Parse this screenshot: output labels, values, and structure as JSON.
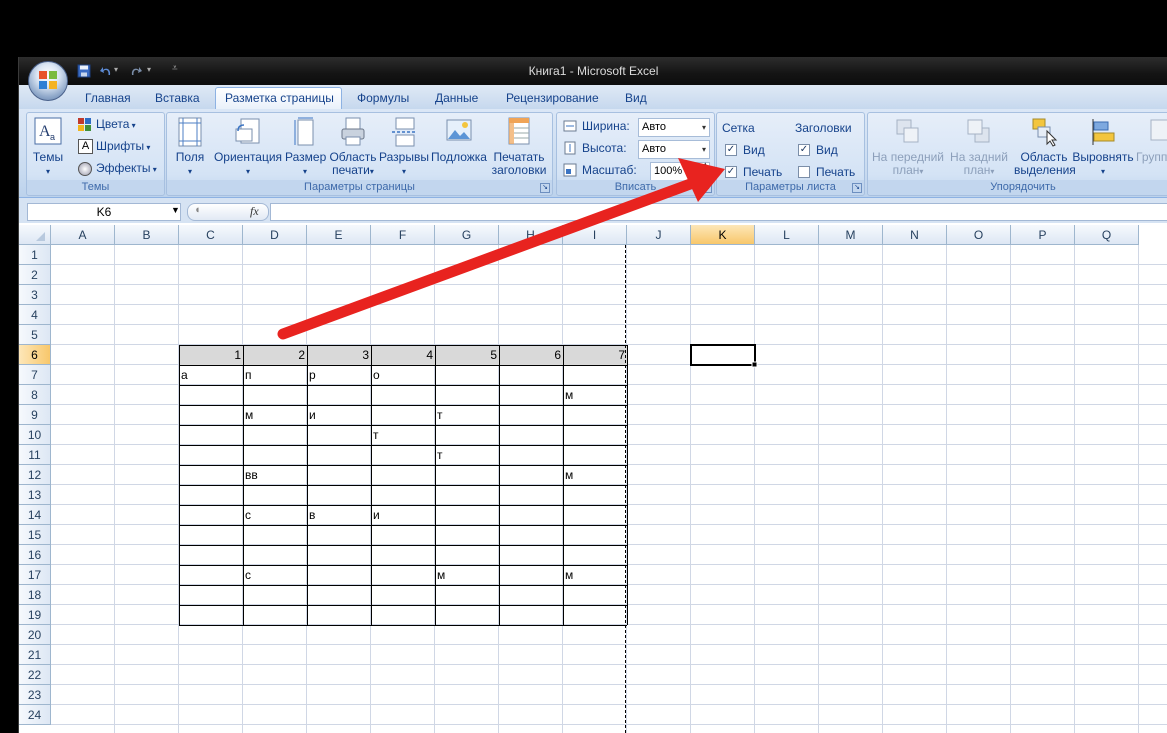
{
  "window": {
    "title": "Книга1 - Microsoft Excel"
  },
  "tabs": [
    "Главная",
    "Вставка",
    "Разметка страницы",
    "Формулы",
    "Данные",
    "Рецензирование",
    "Вид"
  ],
  "ribbon": {
    "themes_group": {
      "title": "Темы",
      "themes_label": "Темы",
      "colors_label": "Цвета",
      "fonts_label": "Шрифты",
      "effects_label": "Эффекты"
    },
    "page_setup_group": {
      "title": "Параметры страницы",
      "margins_label": "Поля",
      "orientation_label": "Ориентация",
      "size_label": "Размер",
      "print_area_label_1": "Область",
      "print_area_label_2": "печати",
      "breaks_label": "Разрывы",
      "background_label": "Подложка",
      "print_titles_label_1": "Печатать",
      "print_titles_label_2": "заголовки"
    },
    "scale_group": {
      "title": "Вписать",
      "width_label": "Ширина:",
      "width_value": "Авто",
      "height_label": "Высота:",
      "height_value": "Авто",
      "scale_label": "Масштаб:",
      "scale_value": "100%"
    },
    "sheet_options_group": {
      "title": "Параметры листа",
      "gridlines_label": "Сетка",
      "headings_label": "Заголовки",
      "view_label": "Вид",
      "print_label": "Печать",
      "gridlines_view_checked": true,
      "gridlines_print_checked": true,
      "headings_view_checked": true,
      "headings_print_checked": false
    },
    "arrange_group": {
      "title": "Упорядочить",
      "bring_forward_1": "На передний",
      "bring_forward_2": "план",
      "send_backward_1": "На задний",
      "send_backward_2": "план",
      "selection_pane_1": "Область",
      "selection_pane_2": "выделения",
      "align_label": "Выровнять",
      "group_label": "Группи"
    }
  },
  "formula_bar": {
    "name_box": "K6",
    "fx": "fx",
    "formula": ""
  },
  "sheet": {
    "columns": [
      "A",
      "B",
      "C",
      "D",
      "E",
      "F",
      "G",
      "H",
      "I",
      "J",
      "K",
      "L",
      "M",
      "N",
      "O",
      "P",
      "Q"
    ],
    "rows": [
      "1",
      "2",
      "3",
      "4",
      "5",
      "6",
      "7",
      "8",
      "9",
      "10",
      "11",
      "12",
      "13",
      "14",
      "15",
      "16",
      "17",
      "18",
      "19",
      "20",
      "21",
      "22",
      "23",
      "24"
    ],
    "selected_cell": "K6",
    "cells": {
      "C6": "1",
      "D6": "2",
      "E6": "3",
      "F6": "4",
      "G6": "5",
      "H6": "6",
      "I6": "7",
      "C7": "а",
      "D7": "п",
      "E7": "р",
      "F7": "о",
      "I8": "м",
      "D9": "м",
      "E9": "и",
      "G9": "т",
      "F10": "т",
      "G11": "т",
      "D12": "вв",
      "I12": "м",
      "D14": "с",
      "E14": "в",
      "F14": "и",
      "D17": "с",
      "G17": "м",
      "I17": "м"
    }
  },
  "colors": {
    "annotation_arrow": "#e8231f",
    "ribbon_text": "#15428b",
    "header_fill": "#d9d9d9"
  }
}
